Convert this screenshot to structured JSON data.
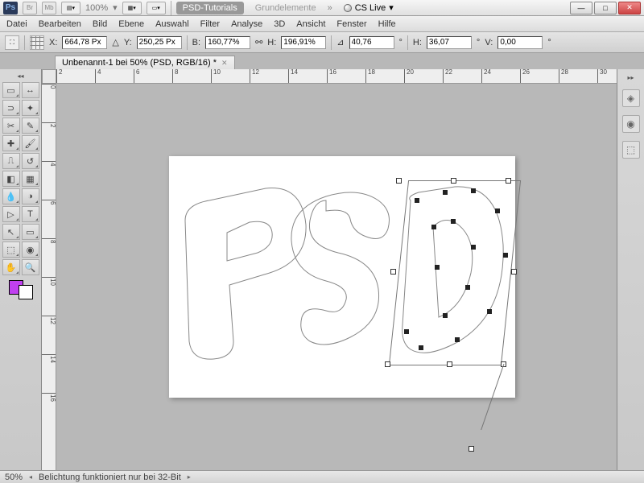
{
  "titlebar": {
    "logo": "Ps",
    "br": "Br",
    "mb": "Mb",
    "zoom": "100%",
    "pill1": "PSD-Tutorials",
    "pill2": "Grundelemente",
    "cslive": "CS Live"
  },
  "winbtns": {
    "min": "—",
    "max": "□",
    "close": "✕"
  },
  "menu": [
    "Datei",
    "Bearbeiten",
    "Bild",
    "Ebene",
    "Auswahl",
    "Filter",
    "Analyse",
    "3D",
    "Ansicht",
    "Fenster",
    "Hilfe"
  ],
  "options": {
    "x_label": "X:",
    "x": "664,78 Px",
    "y_label": "Y:",
    "y": "250,25 Px",
    "w_label": "B:",
    "w": "160,77%",
    "h_label": "H:",
    "h": "196,91%",
    "angle_label": "",
    "angle": "40,76",
    "deg": "°",
    "hsk_label": "H:",
    "hsk": "36,07",
    "vsk_label": "V:",
    "vsk": "0,00"
  },
  "tab": {
    "title": "Unbenannt-1 bei 50% (PSD, RGB/16) *"
  },
  "ruler_h": [
    2,
    4,
    6,
    8,
    10,
    12,
    14,
    16,
    18,
    20,
    22,
    24,
    26,
    28,
    30
  ],
  "ruler_v": [
    0,
    2,
    4,
    6,
    8,
    10,
    12,
    14,
    16
  ],
  "status": {
    "zoom": "50%",
    "msg": "Belichtung funktioniert nur bei 32-Bit"
  },
  "colors": {
    "fg": "#c040f0",
    "bg": "#ffffff"
  }
}
